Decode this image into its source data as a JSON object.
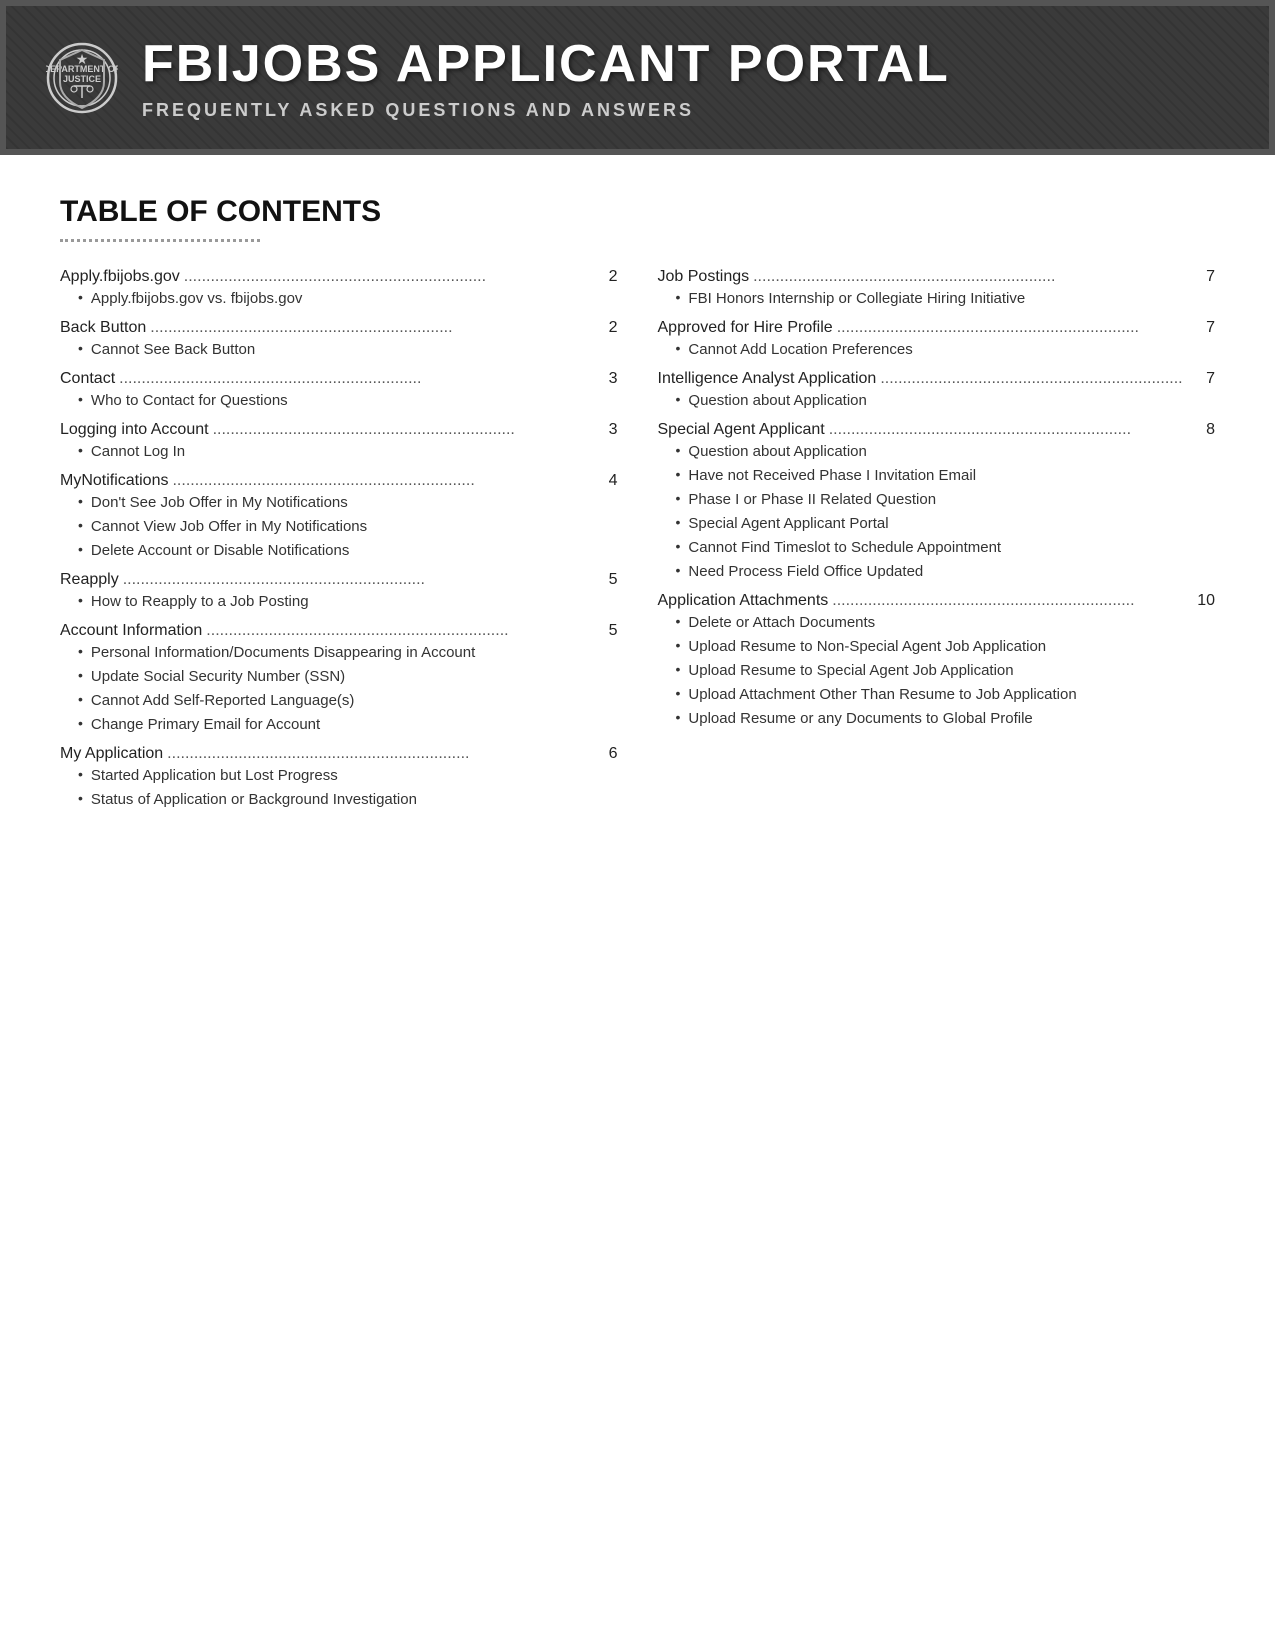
{
  "header": {
    "title": "FBIJOBS APPLICANT PORTAL",
    "subtitle": "FREQUENTLY ASKED QUESTIONS AND ANSWERS"
  },
  "toc": {
    "title": "TABLE OF CONTENTS",
    "divider": true,
    "left_column": [
      {
        "label": "Apply.fbijobs.gov",
        "dots": true,
        "page": "2",
        "sub_items": [
          {
            "label": "Apply.fbijobs.gov vs. fbijobs.gov"
          }
        ]
      },
      {
        "label": "Back Button",
        "dots": true,
        "page": "2",
        "sub_items": [
          {
            "label": "Cannot See Back Button"
          }
        ]
      },
      {
        "label": "Contact",
        "dots": true,
        "page": "3",
        "sub_items": [
          {
            "label": "Who to Contact for Questions"
          }
        ]
      },
      {
        "label": "Logging into Account",
        "dots": true,
        "page": "3",
        "sub_items": [
          {
            "label": "Cannot Log In"
          }
        ]
      },
      {
        "label": "MyNotifications",
        "dots": true,
        "page": "4",
        "sub_items": [
          {
            "label": "Don't See Job Offer in My Notifications"
          },
          {
            "label": "Cannot View Job Offer in My Notifications"
          },
          {
            "label": "Delete Account or Disable Notifications"
          }
        ]
      },
      {
        "label": "Reapply",
        "dots": true,
        "page": "5",
        "sub_items": [
          {
            "label": "How to Reapply to a Job Posting"
          }
        ]
      },
      {
        "label": "Account Information",
        "dots": true,
        "page": "5",
        "sub_items": [
          {
            "label": "Personal Information/Documents Disappearing in Account"
          },
          {
            "label": "Update Social Security Number (SSN)"
          },
          {
            "label": "Cannot Add Self-Reported Language(s)"
          },
          {
            "label": "Change Primary Email for Account"
          }
        ]
      },
      {
        "label": "My Application",
        "dots": true,
        "page": "6",
        "sub_items": [
          {
            "label": "Started Application but Lost Progress"
          },
          {
            "label": "Status of Application or Background Investigation"
          }
        ]
      }
    ],
    "right_column": [
      {
        "label": "Job Postings",
        "dots": true,
        "page": "7",
        "sub_items": [
          {
            "label": "FBI Honors Internship or Collegiate Hiring Initiative"
          }
        ]
      },
      {
        "label": "Approved for Hire Profile",
        "dots": true,
        "page": "7",
        "sub_items": [
          {
            "label": "Cannot Add Location Preferences"
          }
        ]
      },
      {
        "label": "Intelligence Analyst Application",
        "dots": true,
        "page": "7",
        "sub_items": [
          {
            "label": "Question about Application"
          }
        ]
      },
      {
        "label": "Special Agent Applicant",
        "dots": true,
        "page": "8",
        "sub_items": [
          {
            "label": "Question about Application"
          },
          {
            "label": "Have not Received Phase I Invitation Email"
          },
          {
            "label": "Phase I or Phase II Related Question"
          },
          {
            "label": "Special Agent Applicant Portal"
          },
          {
            "label": "Cannot Find Timeslot to Schedule Appointment"
          },
          {
            "label": "Need Process Field Office Updated"
          }
        ]
      },
      {
        "label": "Application Attachments",
        "dots": true,
        "page": "10",
        "sub_items": [
          {
            "label": "Delete or Attach Documents"
          },
          {
            "label": "Upload Resume to Non-Special Agent Job Application"
          },
          {
            "label": "Upload Resume to Special Agent Job Application"
          },
          {
            "label": "Upload Attachment Other Than Resume to Job Application"
          },
          {
            "label": "Upload Resume or any Documents to Global Profile"
          }
        ]
      }
    ]
  }
}
